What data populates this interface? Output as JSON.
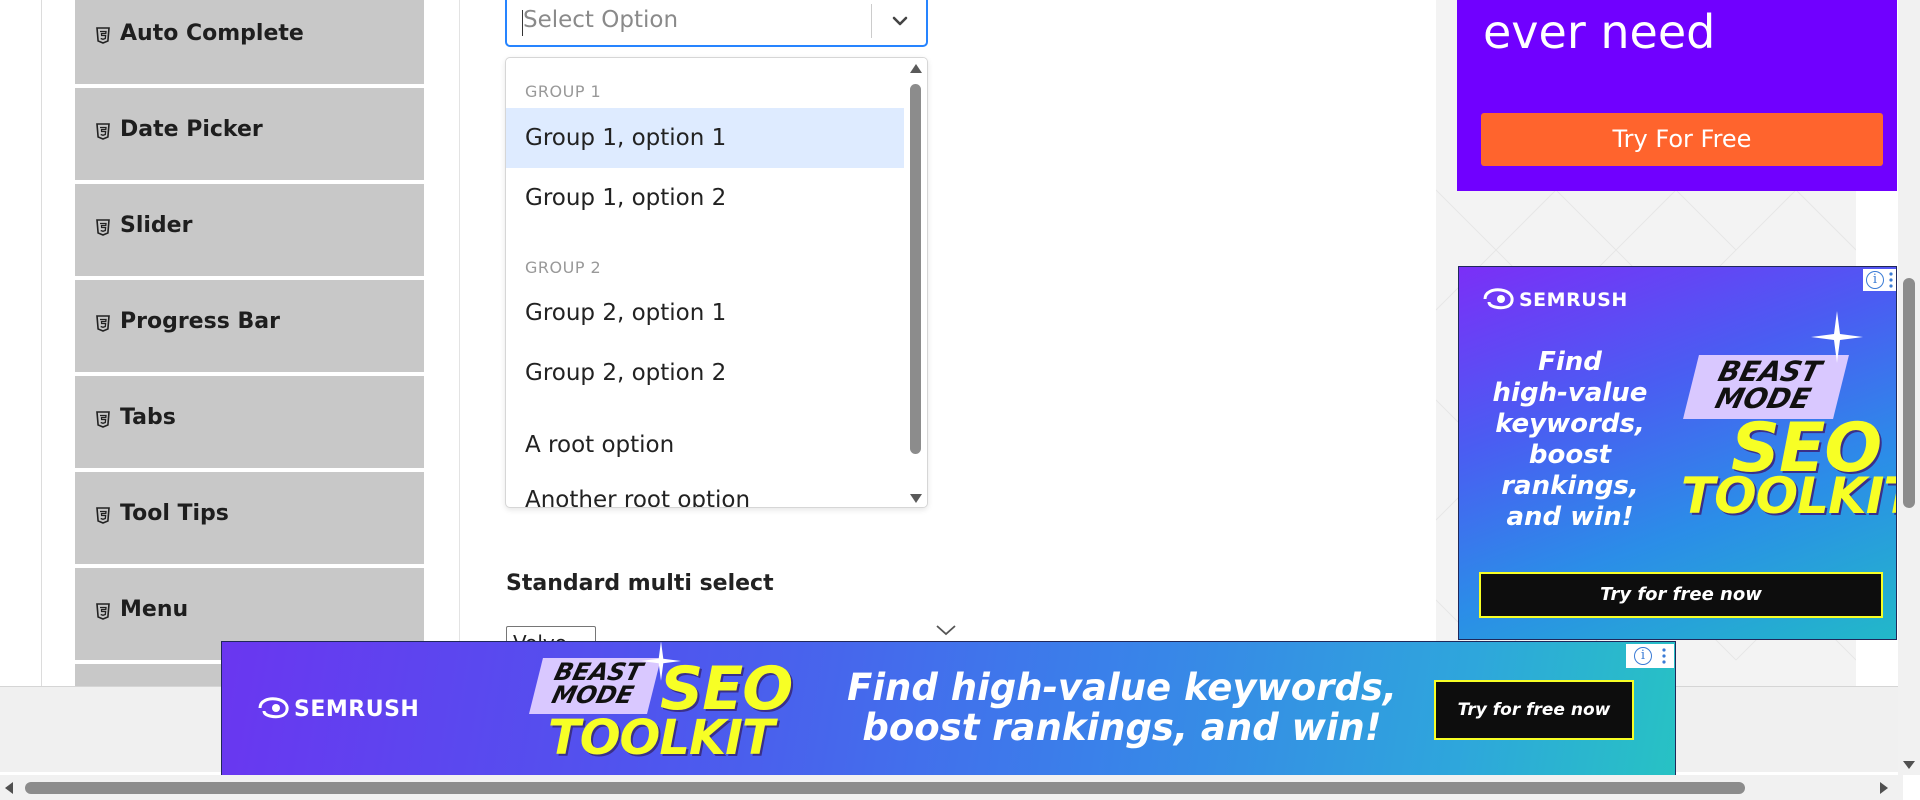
{
  "sidebar": {
    "items": [
      {
        "label": "Auto Complete"
      },
      {
        "label": "Date Picker"
      },
      {
        "label": "Slider"
      },
      {
        "label": "Progress Bar"
      },
      {
        "label": "Tabs"
      },
      {
        "label": "Tool Tips"
      },
      {
        "label": "Menu"
      }
    ]
  },
  "select": {
    "placeholder": "Select Option",
    "menu": {
      "group1_label": "GROUP 1",
      "group1_options": [
        "Group 1, option 1",
        "Group 1, option 2"
      ],
      "group2_label": "GROUP 2",
      "group2_options": [
        "Group 2, option 1",
        "Group 2, option 2"
      ],
      "root_options": [
        "A root option",
        "Another root option"
      ],
      "focused_option": "Group 1, option 1"
    }
  },
  "multi_select": {
    "label": "Standard multi select",
    "visible_value": "Volvo"
  },
  "ads": {
    "top": {
      "headline": "ever need",
      "button": "Try For Free",
      "bg_color": "#7000ff",
      "button_color": "#ff642d"
    },
    "mid": {
      "brand": "SEMRUSH",
      "copy_lines": [
        "Find",
        "high-value",
        "keywords,",
        "boost",
        "rankings,",
        "and win!"
      ],
      "badge_line1": "BEAST",
      "badge_line2": "MODE",
      "seo": "SEO",
      "toolkit": "TOOLKIT",
      "button": "Try for free now"
    },
    "bottom": {
      "brand": "SEMRUSH",
      "badge_line1": "BEAST",
      "badge_line2": "MODE",
      "seo": "SEO",
      "toolkit": "TOOLKIT",
      "copy_line1": "Find high-value keywords,",
      "copy_line2": "boost rankings, and win!",
      "button": "Try for free now"
    }
  },
  "colors": {
    "sidebar_bg": "#c8c8c8",
    "focus_border": "#2684ff",
    "focused_option_bg": "#deebff"
  }
}
